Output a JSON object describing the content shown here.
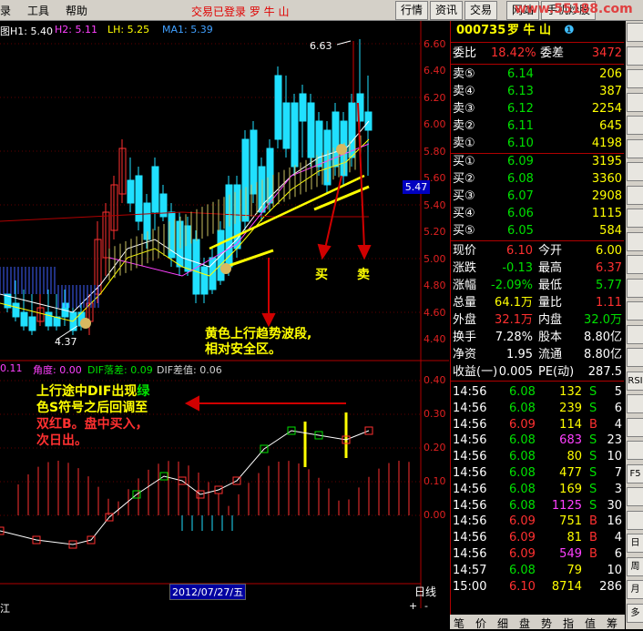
{
  "menu": {
    "items": [
      "录",
      "工具",
      "帮助"
    ],
    "login_status": "交易已登录 罗 牛 山"
  },
  "toolbar": {
    "tabs": [
      "行情",
      "资讯",
      "交易",
      "网站",
      "手机炒股"
    ],
    "logo_text": "www.55188.com"
  },
  "chart": {
    "ma_header": {
      "h1": "图H1: 5.40",
      "h2": "H2: 5.11",
      "lh": "LH: 5.25",
      "ma1": "MA1: 5.39"
    },
    "price_axis": [
      "6.60",
      "6.40",
      "6.20",
      "6.00",
      "5.80",
      "5.60",
      "5.40",
      "5.20",
      "5.00",
      "4.80",
      "4.60",
      "4.40"
    ],
    "current_price_tag": "5.47",
    "high_label": "6.63",
    "low_label": "4.37",
    "annotations": {
      "buy": "买",
      "sell": "卖",
      "trend_line1": "黄色上行趋势波段,",
      "trend_line2": "相对安全区。",
      "macd_line1a": "上行途中DIF出现",
      "macd_line1b": "绿",
      "macd_line2": "色S符号之后回调至",
      "macd_line3": "双红B。盘中买入，",
      "macd_line4": "次日出。"
    },
    "indicator_header": {
      "v1": "0.11",
      "angle": "角度: 0.00",
      "dif_drop": "DIF落差: 0.09",
      "dif_diff": "DIF差值: 0.06"
    },
    "indicator_axis": [
      "0.40",
      "0.30",
      "0.20",
      "0.10",
      "0.00"
    ],
    "date_label": "2012/07/27/五",
    "period_label": "日线",
    "bottom_left": "江",
    "zoom_plus": "+",
    "zoom_minus": "-"
  },
  "quote": {
    "code": "000735",
    "name": "罗 牛 山",
    "weibi_label": "委比",
    "weibi": "18.42%",
    "weicha_label": "委差",
    "weicha": "3472",
    "sell": [
      {
        "label": "卖⑤",
        "price": "6.14",
        "vol": "206"
      },
      {
        "label": "卖④",
        "price": "6.13",
        "vol": "387"
      },
      {
        "label": "卖③",
        "price": "6.12",
        "vol": "2254"
      },
      {
        "label": "卖②",
        "price": "6.11",
        "vol": "645"
      },
      {
        "label": "卖①",
        "price": "6.10",
        "vol": "4198"
      }
    ],
    "buy": [
      {
        "label": "买①",
        "price": "6.09",
        "vol": "3195"
      },
      {
        "label": "买②",
        "price": "6.08",
        "vol": "3360"
      },
      {
        "label": "买③",
        "price": "6.07",
        "vol": "2908"
      },
      {
        "label": "买④",
        "price": "6.06",
        "vol": "1115"
      },
      {
        "label": "买⑤",
        "price": "6.05",
        "vol": "584"
      }
    ],
    "stats": [
      {
        "l1": "现价",
        "v1": "6.10",
        "l2": "今开",
        "v2": "6.00"
      },
      {
        "l1": "涨跌",
        "v1": "-0.13",
        "l2": "最高",
        "v2": "6.37"
      },
      {
        "l1": "涨幅",
        "v1": "-2.09%",
        "l2": "最低",
        "v2": "5.77"
      },
      {
        "l1": "总量",
        "v1": "64.1万",
        "l2": "量比",
        "v2": "1.11"
      },
      {
        "l1": "外盘",
        "v1": "32.1万",
        "l2": "内盘",
        "v2": "32.0万"
      },
      {
        "l1": "换手",
        "v1": "7.28%",
        "l2": "股本",
        "v2": "8.80亿"
      },
      {
        "l1": "净资",
        "v1": "1.95",
        "l2": "流通",
        "v2": "8.80亿"
      },
      {
        "l1": "收益(一)",
        "v1": "0.005",
        "l2": "PE(动)",
        "v2": "287.5"
      }
    ],
    "ticks": [
      {
        "t": "14:56",
        "p": "6.08",
        "v": "132",
        "d": "S",
        "n": "5"
      },
      {
        "t": "14:56",
        "p": "6.08",
        "v": "239",
        "d": "S",
        "n": "6"
      },
      {
        "t": "14:56",
        "p": "6.09",
        "v": "114",
        "d": "B",
        "n": "4"
      },
      {
        "t": "14:56",
        "p": "6.08",
        "v": "683",
        "d": "S",
        "n": "23"
      },
      {
        "t": "14:56",
        "p": "6.08",
        "v": "80",
        "d": "S",
        "n": "10"
      },
      {
        "t": "14:56",
        "p": "6.08",
        "v": "477",
        "d": "S",
        "n": "7"
      },
      {
        "t": "14:56",
        "p": "6.08",
        "v": "169",
        "d": "S",
        "n": "3"
      },
      {
        "t": "14:56",
        "p": "6.08",
        "v": "1125",
        "d": "S",
        "n": "30"
      },
      {
        "t": "14:56",
        "p": "6.09",
        "v": "751",
        "d": "B",
        "n": "16"
      },
      {
        "t": "14:56",
        "p": "6.09",
        "v": "81",
        "d": "B",
        "n": "4"
      },
      {
        "t": "14:56",
        "p": "6.09",
        "v": "549",
        "d": "B",
        "n": "6"
      },
      {
        "t": "14:57",
        "p": "6.08",
        "v": "79",
        "d": "",
        "n": "10"
      },
      {
        "t": "15:00",
        "p": "6.10",
        "v": "8714",
        "d": "",
        "n": "286"
      }
    ],
    "bottom_tabs": [
      "笔",
      "价",
      "细",
      "盘",
      "势",
      "指",
      "值",
      "筹"
    ]
  },
  "side_buttons": [
    "",
    "",
    "",
    "",
    "",
    "",
    "",
    "",
    "",
    "",
    "",
    "",
    "",
    "",
    "",
    "RSI",
    "",
    "",
    "",
    "F5",
    "",
    "",
    "日",
    "周",
    "月",
    "多"
  ]
}
